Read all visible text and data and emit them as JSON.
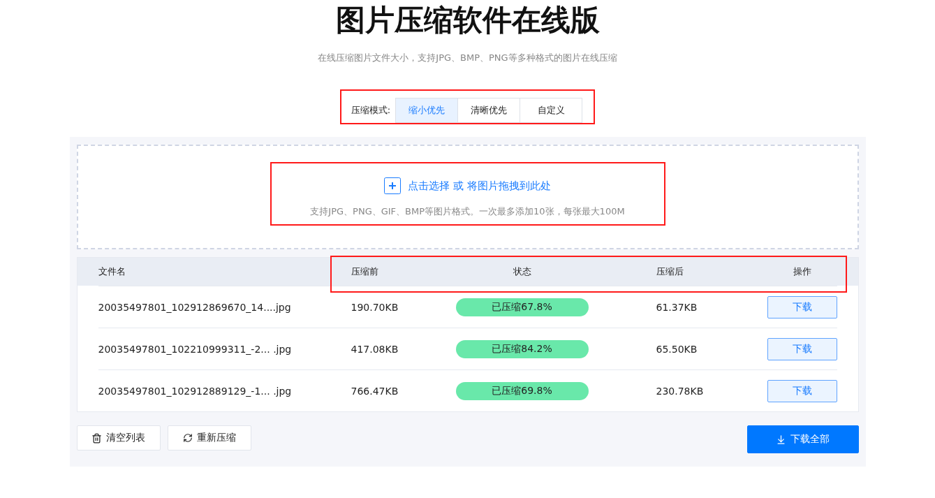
{
  "title": "图片压缩软件在线版",
  "subtitle": "在线压缩图片文件大小，支持JPG、BMP、PNG等多种格式的图片在线压缩",
  "mode_bar": {
    "label": "压缩模式:",
    "highlighted": true,
    "tabs": [
      {
        "label": "缩小优先",
        "selected": true
      },
      {
        "label": "清晰优先",
        "selected": false
      },
      {
        "label": "自定义",
        "selected": false
      }
    ]
  },
  "upload": {
    "highlighted": true,
    "prompt": "点击选择 或 将图片拖拽到此处",
    "hint": "支持JPG、PNG、GIF、BMP等图片格式。一次最多添加10张，每张最大100M"
  },
  "table": {
    "header_highlighted": true,
    "columns": [
      "文件名",
      "压缩前",
      "状态",
      "压缩后",
      "操作"
    ],
    "rows": [
      {
        "file": "20035497801_102912869670_14....jpg",
        "before": "190.70KB",
        "status": "已压缩67.8%",
        "after": "61.37KB",
        "action": "下载"
      },
      {
        "file": "20035497801_102210999311_-2... .jpg",
        "before": "417.08KB",
        "status": "已压缩84.2%",
        "after": "65.50KB",
        "action": "下载"
      },
      {
        "file": "20035497801_102912889129_-1... .jpg",
        "before": "766.47KB",
        "status": "已压缩69.8%",
        "after": "230.78KB",
        "action": "下载"
      }
    ]
  },
  "actions": [
    {
      "kind": "clear",
      "label": "清空列表"
    },
    {
      "kind": "recompress",
      "label": "重新压缩"
    },
    {
      "kind": "download_all",
      "label": "下载全部"
    }
  ]
}
